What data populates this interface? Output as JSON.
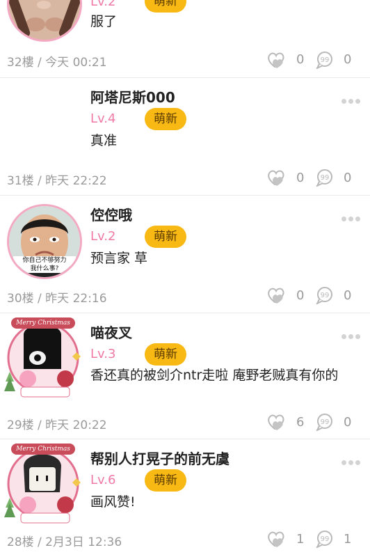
{
  "posts": [
    {
      "floor_time": "32樓 / 今天 00:21",
      "level": "Lv.2",
      "badge": "萌新",
      "content": "服了",
      "likes": "0",
      "replies": "0"
    },
    {
      "username": "阿塔尼斯000",
      "level": "Lv.4",
      "badge": "萌新",
      "content": "真准",
      "floor_time": "31楼 / 昨天 22:22",
      "likes": "0",
      "replies": "0"
    },
    {
      "username": "倥倥哦",
      "level": "Lv.2",
      "badge": "萌新",
      "content": "预言家 草",
      "floor_time": "30楼 / 昨天 22:16",
      "likes": "0",
      "replies": "0",
      "avatar_caption_line1": "你自己不够努力",
      "avatar_caption_line2": "我什么事?"
    },
    {
      "username": "喵夜叉",
      "level": "Lv.3",
      "badge": "萌新",
      "content": "香还真的被剑介ntr走啦 庵野老贼真有你的",
      "floor_time": "29楼 / 昨天 20:22",
      "likes": "6",
      "replies": "0",
      "avatar_ribbon": "Merry Christmas"
    },
    {
      "username": "帮别人打晃子的前无虞",
      "level": "Lv.6",
      "badge": "萌新",
      "content": "画风赞!",
      "floor_time": "28楼 / 2月3日 12:36",
      "likes": "1",
      "replies": "1",
      "avatar_ribbon": "Merry Christmas"
    }
  ],
  "colors": {
    "badge_bg": "#f8b915",
    "level_text": "#ef7aa6",
    "meta_text": "#9a9a9a",
    "avatar_ring": "#f3a9c2"
  },
  "icons": [
    "heart-like-icon",
    "speech-bubble-reply-icon",
    "more-dots-icon"
  ]
}
